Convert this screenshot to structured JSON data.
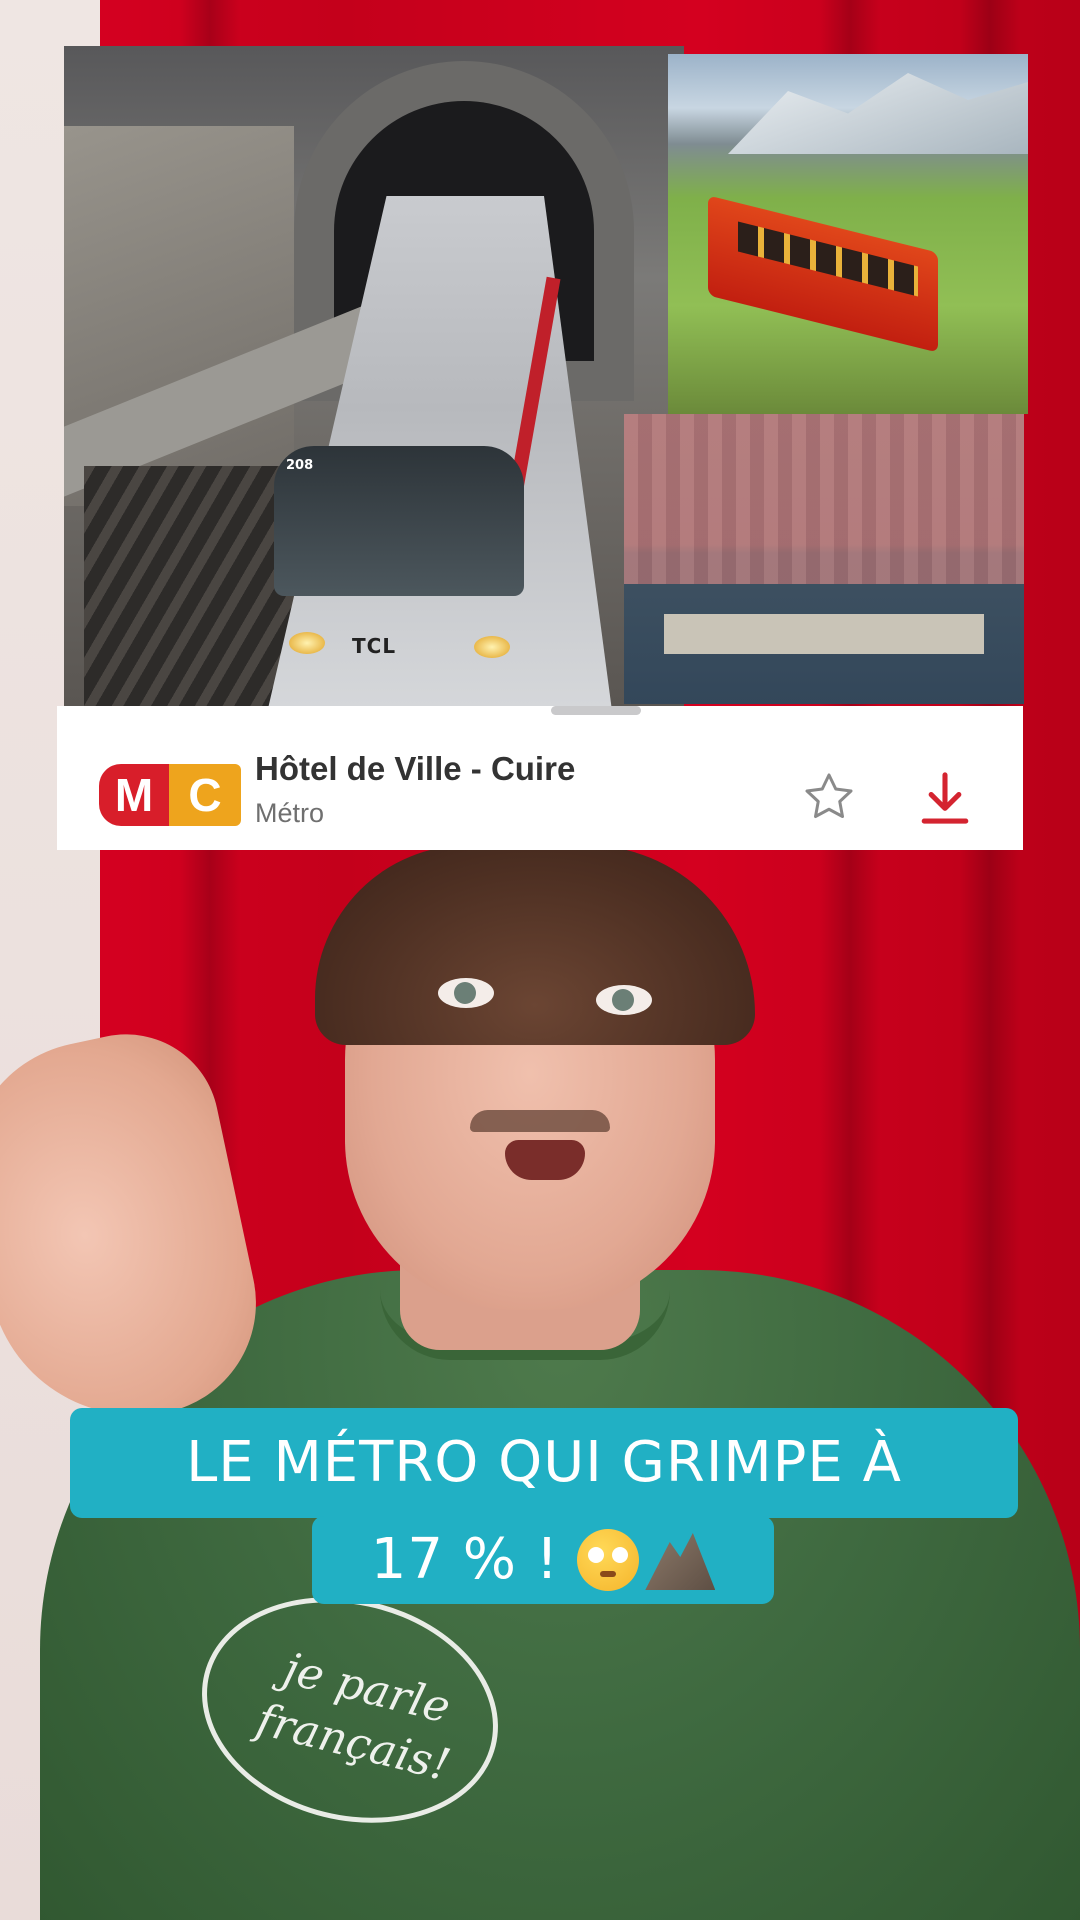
{
  "line_card": {
    "badge_m": "M",
    "badge_c": "C",
    "station": "Hôtel de Ville - Cuire",
    "mode": "Métro",
    "favorite_icon": "star-outline-icon",
    "download_icon": "download-icon"
  },
  "photos": {
    "metro_train_number": "208",
    "metro_train_logo": "TCL"
  },
  "shirt": {
    "print_text": "je parle français!"
  },
  "caption": {
    "line1": "LE MÉTRO QUI GRIMPE À",
    "line2": "17 % !",
    "emoji1": "flushed-face-emoji",
    "emoji2": "mountain-emoji"
  },
  "colors": {
    "caption_bg": "#21b0c4",
    "badge_red": "#d81e2a",
    "badge_orange": "#eea41d",
    "download_red": "#d42430",
    "curtain_red": "#c8001a"
  }
}
